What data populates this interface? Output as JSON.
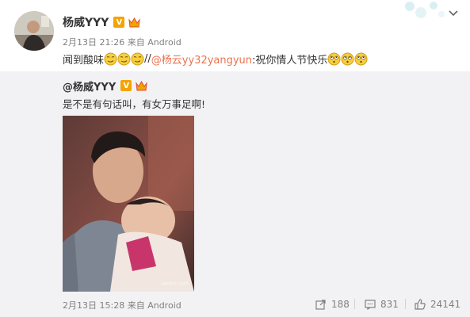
{
  "post": {
    "author": "杨威YYY",
    "date": "2月13日 21:26",
    "source": "来自 Android",
    "text_before": "闻到酸味",
    "separator": "//",
    "mention": "@杨云yy32yangyun",
    "text_after": ":祝你情人节快乐"
  },
  "repost": {
    "author": "@杨威YYY",
    "text": "是不是有句话叫，有女万事足啊!",
    "date": "2月13日 15:28",
    "source": "来自 Android",
    "photo_watermark": "weibo.com",
    "actions": {
      "share_count": "188",
      "comment_count": "831",
      "like_count": "24141"
    }
  },
  "colors": {
    "mention": "#eb7350",
    "verified_badge": "#f4a300",
    "repost_bg": "#f2f2f5",
    "muted_text": "#808080"
  },
  "icons": [
    "verified-icon",
    "member-icon",
    "smirk-emoji",
    "dizzy-emoji",
    "chevron-down-icon",
    "share-icon",
    "comment-icon",
    "like-icon"
  ]
}
